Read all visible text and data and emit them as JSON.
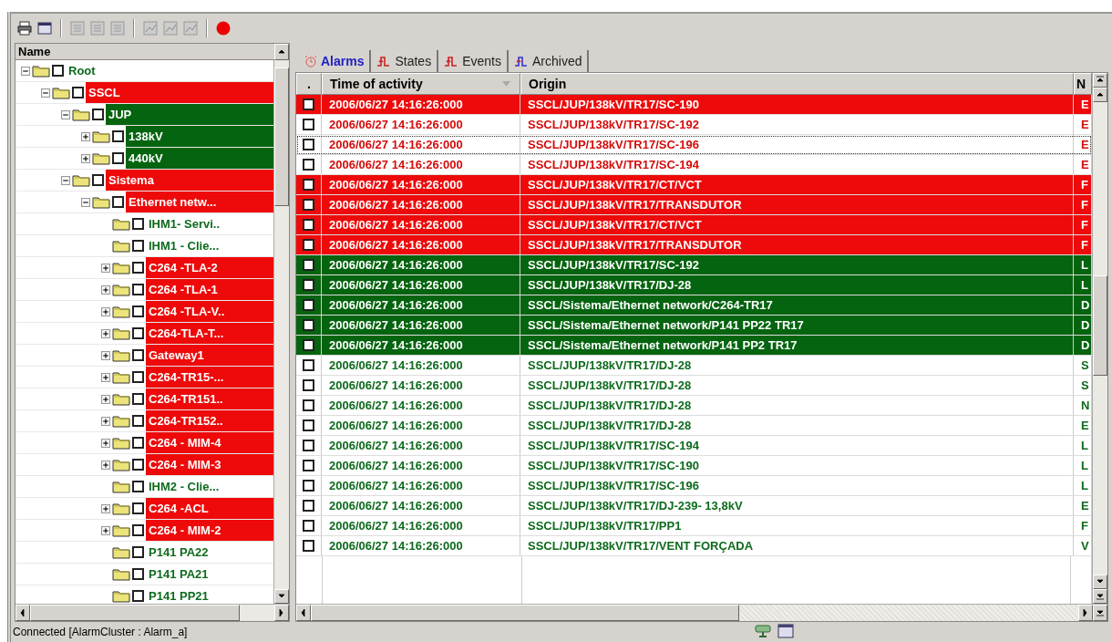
{
  "tree": {
    "header": "Name",
    "nodes": [
      {
        "label": "Root",
        "alarm": false,
        "highlighted": false,
        "expandable": true,
        "expanded": true,
        "checked": false,
        "children": [
          {
            "label": "SSCL",
            "alarm": true,
            "highlighted": true,
            "expandable": true,
            "expanded": true,
            "checked": false,
            "children": [
              {
                "label": "JUP",
                "alarm": false,
                "highlighted": true,
                "expandable": true,
                "expanded": true,
                "checked": false,
                "children": [
                  {
                    "label": "138kV",
                    "alarm": false,
                    "highlighted": true,
                    "expandable": true,
                    "expanded": false,
                    "checked": false
                  },
                  {
                    "label": "440kV",
                    "alarm": false,
                    "highlighted": true,
                    "expandable": true,
                    "expanded": false,
                    "checked": false
                  }
                ]
              },
              {
                "label": "Sistema",
                "alarm": true,
                "highlighted": true,
                "expandable": true,
                "expanded": true,
                "checked": false,
                "children": [
                  {
                    "label": "Ethernet netw...",
                    "alarm": true,
                    "highlighted": true,
                    "expandable": true,
                    "expanded": true,
                    "checked": false,
                    "children": [
                      {
                        "label": "IHM1- Servi..",
                        "alarm": false,
                        "highlighted": false,
                        "expandable": false,
                        "checked": false
                      },
                      {
                        "label": "IHM1 - Clie...",
                        "alarm": false,
                        "highlighted": false,
                        "expandable": false,
                        "checked": false
                      },
                      {
                        "label": "C264 -TLA-2",
                        "alarm": true,
                        "highlighted": true,
                        "expandable": true,
                        "expanded": false,
                        "checked": false
                      },
                      {
                        "label": "C264 -TLA-1",
                        "alarm": true,
                        "highlighted": true,
                        "expandable": true,
                        "expanded": false,
                        "checked": false
                      },
                      {
                        "label": "C264 -TLA-V..",
                        "alarm": true,
                        "highlighted": true,
                        "expandable": true,
                        "expanded": false,
                        "checked": false
                      },
                      {
                        "label": "C264-TLA-T...",
                        "alarm": true,
                        "highlighted": true,
                        "expandable": true,
                        "expanded": false,
                        "checked": false
                      },
                      {
                        "label": "Gateway1",
                        "alarm": true,
                        "highlighted": true,
                        "expandable": true,
                        "expanded": false,
                        "checked": false
                      },
                      {
                        "label": "C264-TR15-...",
                        "alarm": true,
                        "highlighted": true,
                        "expandable": true,
                        "expanded": false,
                        "checked": false
                      },
                      {
                        "label": "C264-TR151..",
                        "alarm": true,
                        "highlighted": true,
                        "expandable": true,
                        "expanded": false,
                        "checked": false
                      },
                      {
                        "label": "C264-TR152..",
                        "alarm": true,
                        "highlighted": true,
                        "expandable": true,
                        "expanded": false,
                        "checked": false
                      },
                      {
                        "label": "C264 - MIM-4",
                        "alarm": true,
                        "highlighted": true,
                        "expandable": true,
                        "expanded": false,
                        "checked": false
                      },
                      {
                        "label": "C264 - MIM-3",
                        "alarm": true,
                        "highlighted": true,
                        "expandable": true,
                        "expanded": false,
                        "checked": false
                      },
                      {
                        "label": "IHM2 - Clie...",
                        "alarm": false,
                        "highlighted": false,
                        "expandable": false,
                        "checked": false
                      },
                      {
                        "label": "C264 -ACL",
                        "alarm": true,
                        "highlighted": true,
                        "expandable": true,
                        "expanded": false,
                        "checked": false
                      },
                      {
                        "label": "C264 - MIM-2",
                        "alarm": true,
                        "highlighted": true,
                        "expandable": true,
                        "expanded": false,
                        "checked": false
                      },
                      {
                        "label": "P141 PA22",
                        "alarm": false,
                        "highlighted": false,
                        "expandable": false,
                        "checked": false
                      },
                      {
                        "label": "P141 PA21",
                        "alarm": false,
                        "highlighted": false,
                        "expandable": false,
                        "checked": false
                      },
                      {
                        "label": "P141 PP21",
                        "alarm": false,
                        "highlighted": false,
                        "expandable": false,
                        "checked": false
                      }
                    ]
                  }
                ]
              }
            ]
          }
        ]
      }
    ]
  },
  "tabs": [
    {
      "label": "Alarms",
      "selected": true
    },
    {
      "label": "States",
      "selected": false
    },
    {
      "label": "Events",
      "selected": false
    },
    {
      "label": "Archived",
      "selected": false
    }
  ],
  "alarms": {
    "columns": [
      ".",
      "Time of activity",
      "Origin",
      "N"
    ],
    "rows": [
      {
        "checked": false,
        "alarm": true,
        "highlighted": true,
        "focused": false,
        "time": "2006/06/27 14:16:26:000",
        "origin": "SSCL/JUP/138kV/TR17/SC-190",
        "column_3": "E"
      },
      {
        "checked": false,
        "alarm": true,
        "highlighted": false,
        "focused": false,
        "time": "2006/06/27 14:16:26:000",
        "origin": "SSCL/JUP/138kV/TR17/SC-192",
        "column_3": "E"
      },
      {
        "checked": false,
        "alarm": true,
        "highlighted": false,
        "focused": true,
        "time": "2006/06/27 14:16:26:000",
        "origin": "SSCL/JUP/138kV/TR17/SC-196",
        "column_3": "E"
      },
      {
        "checked": false,
        "alarm": true,
        "highlighted": false,
        "focused": false,
        "time": "2006/06/27 14:16:26:000",
        "origin": "SSCL/JUP/138kV/TR17/SC-194",
        "column_3": "E"
      },
      {
        "checked": false,
        "alarm": true,
        "highlighted": true,
        "focused": false,
        "time": "2006/06/27 14:16:26:000",
        "origin": "SSCL/JUP/138kV/TR17/CT/VCT",
        "column_3": "F"
      },
      {
        "checked": false,
        "alarm": true,
        "highlighted": true,
        "focused": false,
        "time": "2006/06/27 14:16:26:000",
        "origin": "SSCL/JUP/138kV/TR17/TRANSDUTOR",
        "column_3": "F"
      },
      {
        "checked": false,
        "alarm": true,
        "highlighted": true,
        "focused": false,
        "time": "2006/06/27 14:16:26:000",
        "origin": "SSCL/JUP/138kV/TR17/CT/VCT",
        "column_3": "F"
      },
      {
        "checked": false,
        "alarm": true,
        "highlighted": true,
        "focused": false,
        "time": "2006/06/27 14:16:26:000",
        "origin": "SSCL/JUP/138kV/TR17/TRANSDUTOR",
        "column_3": "F"
      },
      {
        "checked": false,
        "alarm": false,
        "highlighted": true,
        "focused": false,
        "time": "2006/06/27 14:16:26:000",
        "origin": "SSCL/JUP/138kV/TR17/SC-192",
        "column_3": "L"
      },
      {
        "checked": false,
        "alarm": false,
        "highlighted": true,
        "focused": false,
        "time": "2006/06/27 14:16:26:000",
        "origin": "SSCL/JUP/138kV/TR17/DJ-28",
        "column_3": "L"
      },
      {
        "checked": false,
        "alarm": false,
        "highlighted": true,
        "focused": false,
        "time": "2006/06/27 14:16:26:000",
        "origin": "SSCL/Sistema/Ethernet network/C264-TR17",
        "column_3": "D"
      },
      {
        "checked": false,
        "alarm": false,
        "highlighted": true,
        "focused": false,
        "time": "2006/06/27 14:16:26:000",
        "origin": "SSCL/Sistema/Ethernet network/P141 PP22 TR17",
        "column_3": "D"
      },
      {
        "checked": false,
        "alarm": false,
        "highlighted": true,
        "focused": false,
        "time": "2006/06/27 14:16:26:000",
        "origin": "SSCL/Sistema/Ethernet network/P141 PP2 TR17",
        "column_3": "D"
      },
      {
        "checked": false,
        "alarm": false,
        "highlighted": false,
        "focused": false,
        "time": "2006/06/27 14:16:26:000",
        "origin": "SSCL/JUP/138kV/TR17/DJ-28",
        "column_3": "S"
      },
      {
        "checked": false,
        "alarm": false,
        "highlighted": false,
        "focused": false,
        "time": "2006/06/27 14:16:26:000",
        "origin": "SSCL/JUP/138kV/TR17/DJ-28",
        "column_3": "S"
      },
      {
        "checked": false,
        "alarm": false,
        "highlighted": false,
        "focused": false,
        "time": "2006/06/27 14:16:26:000",
        "origin": "SSCL/JUP/138kV/TR17/DJ-28",
        "column_3": "N"
      },
      {
        "checked": false,
        "alarm": false,
        "highlighted": false,
        "focused": false,
        "time": "2006/06/27 14:16:26:000",
        "origin": "SSCL/JUP/138kV/TR17/DJ-28",
        "column_3": "E"
      },
      {
        "checked": false,
        "alarm": false,
        "highlighted": false,
        "focused": false,
        "time": "2006/06/27 14:16:26:000",
        "origin": "SSCL/JUP/138kV/TR17/SC-194",
        "column_3": "L"
      },
      {
        "checked": false,
        "alarm": false,
        "highlighted": false,
        "focused": false,
        "time": "2006/06/27 14:16:26:000",
        "origin": "SSCL/JUP/138kV/TR17/SC-190",
        "column_3": "L"
      },
      {
        "checked": false,
        "alarm": false,
        "highlighted": false,
        "focused": false,
        "time": "2006/06/27 14:16:26:000",
        "origin": "SSCL/JUP/138kV/TR17/SC-196",
        "column_3": "L"
      },
      {
        "checked": false,
        "alarm": false,
        "highlighted": false,
        "focused": false,
        "time": "2006/06/27 14:16:26:000",
        "origin": "SSCL/JUP/138kV/TR17/DJ-239- 13,8kV",
        "column_3": "E"
      },
      {
        "checked": false,
        "alarm": false,
        "highlighted": false,
        "focused": false,
        "time": "2006/06/27 14:16:26:000",
        "origin": "SSCL/JUP/138kV/TR17/PP1",
        "column_3": "F"
      },
      {
        "checked": false,
        "alarm": false,
        "highlighted": false,
        "focused": false,
        "time": "2006/06/27 14:16:26:000",
        "origin": "SSCL/JUP/138kV/TR17/VENT FORÇADA",
        "column_3": "V"
      }
    ]
  },
  "status_bar": {
    "text": "Connected [AlarmCluster : Alarm_a]"
  }
}
